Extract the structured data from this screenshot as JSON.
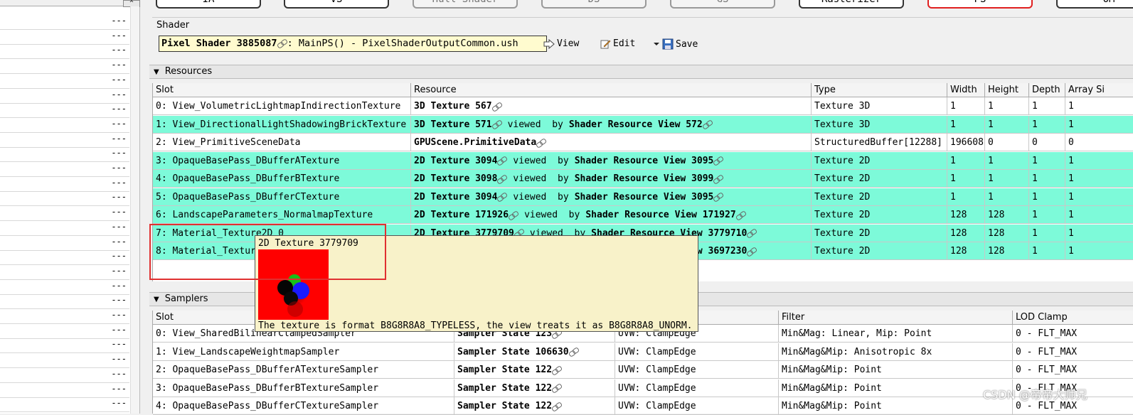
{
  "pipeline": {
    "stages": [
      {
        "label": "IA",
        "state": "normal"
      },
      {
        "label": "VS",
        "state": "normal"
      },
      {
        "label": "Hull Shader",
        "state": "disabled"
      },
      {
        "label": "DS",
        "state": "disabled"
      },
      {
        "label": "GS",
        "state": "disabled"
      },
      {
        "label": "Rasterizer",
        "state": "normal"
      },
      {
        "label": "PS",
        "state": "active"
      },
      {
        "label": "OM",
        "state": "normal"
      }
    ]
  },
  "left_panel": {
    "scroll_arrow": "^",
    "row_value": "---",
    "rows": [
      "---",
      "---",
      "---",
      "---",
      "---",
      "---",
      "---",
      "---",
      "---",
      "---",
      "---",
      "---",
      "---",
      "---",
      "---",
      "---",
      "---",
      "---",
      "---",
      "---",
      "---",
      "---",
      "---",
      "---",
      "---",
      "---",
      "---"
    ]
  },
  "shader": {
    "group_title": "Shader",
    "name_bold": "Pixel Shader 3885087",
    "name_rest": ":  MainPS()  -  PixelShaderOutputCommon.ush",
    "view_label": "View",
    "edit_label": "Edit",
    "save_label": "Save"
  },
  "resources": {
    "section_title": "Resources",
    "columns": [
      "Slot",
      "Resource",
      "Type",
      "Width",
      "Height",
      "Depth",
      "Array Si"
    ],
    "rows": [
      {
        "slot": "0: View_VolumetricLightmapIndirectionTexture",
        "resource": "3D Texture 567",
        "viewed_by": "",
        "view": "",
        "type": "Texture 3D",
        "width": "1",
        "height": "1",
        "depth": "1",
        "array": "1",
        "highlight": false
      },
      {
        "slot": "1: View_DirectionalLightShadowingBrickTexture",
        "resource": "3D Texture 571",
        "viewed_by": "viewed  by",
        "view": "Shader Resource View 572",
        "type": "Texture 3D",
        "width": "1",
        "height": "1",
        "depth": "1",
        "array": "1",
        "highlight": true
      },
      {
        "slot": "2: View_PrimitiveSceneData",
        "resource": "GPUScene.PrimitiveData",
        "viewed_by": "",
        "view": "",
        "type": "StructuredBuffer[12288]",
        "width": "196608",
        "height": "0",
        "depth": "0",
        "array": "0",
        "highlight": false
      },
      {
        "slot": "3: OpaqueBasePass_DBufferATexture",
        "resource": "2D Texture 3094",
        "viewed_by": "viewed  by",
        "view": "Shader Resource View 3095",
        "type": "Texture 2D",
        "width": "1",
        "height": "1",
        "depth": "1",
        "array": "1",
        "highlight": true
      },
      {
        "slot": "4: OpaqueBasePass_DBufferBTexture",
        "resource": "2D Texture 3098",
        "viewed_by": "viewed  by",
        "view": "Shader Resource View 3099",
        "type": "Texture 2D",
        "width": "1",
        "height": "1",
        "depth": "1",
        "array": "1",
        "highlight": true
      },
      {
        "slot": "5: OpaqueBasePass_DBufferCTexture",
        "resource": "2D Texture 3094",
        "viewed_by": "viewed  by",
        "view": "Shader Resource View 3095",
        "type": "Texture 2D",
        "width": "1",
        "height": "1",
        "depth": "1",
        "array": "1",
        "highlight": true
      },
      {
        "slot": "6: LandscapeParameters_NormalmapTexture",
        "resource": "2D Texture 171926",
        "viewed_by": "viewed  by",
        "view": "Shader Resource View 171927",
        "type": "Texture 2D",
        "width": "128",
        "height": "128",
        "depth": "1",
        "array": "1",
        "highlight": true
      },
      {
        "slot": "7: Material_Texture2D_0",
        "resource": "2D Texture 3779709",
        "viewed_by": "viewed  by",
        "view": "Shader Resource View 3779710",
        "type": "Texture 2D",
        "width": "128",
        "height": "128",
        "depth": "1",
        "array": "1",
        "highlight": true
      },
      {
        "slot": "8: Material_Texture2D_1",
        "resource": "2D Texture 3697229",
        "viewed_by": "viewed  by",
        "view": "Shader Resource View 3697230",
        "type": "Texture 2D",
        "width": "128",
        "height": "128",
        "depth": "1",
        "array": "1",
        "highlight": true
      }
    ]
  },
  "samplers": {
    "section_title": "Samplers",
    "columns": [
      "Slot",
      "",
      "",
      "Filter",
      "LOD Clamp"
    ],
    "rows": [
      {
        "slot": "0: View_SharedBilinearClampedSampler",
        "sampler": "Sampler State 123",
        "address": "UVW: ClampEdge",
        "filter": "Min&Mag: Linear, Mip: Point",
        "lod": "0 - FLT_MAX"
      },
      {
        "slot": "1: View_LandscapeWeightmapSampler",
        "sampler": "Sampler State 106630",
        "address": "UVW: ClampEdge",
        "filter": "Min&Mag&Mip: Anisotropic 8x",
        "lod": "0 - FLT_MAX"
      },
      {
        "slot": "2: OpaqueBasePass_DBufferATextureSampler",
        "sampler": "Sampler State 122",
        "address": "UVW: ClampEdge",
        "filter": "Min&Mag&Mip: Point",
        "lod": "0 - FLT_MAX"
      },
      {
        "slot": "3: OpaqueBasePass_DBufferBTextureSampler",
        "sampler": "Sampler State 122",
        "address": "UVW: ClampEdge",
        "filter": "Min&Mag&Mip: Point",
        "lod": "0 - FLT_MAX"
      },
      {
        "slot": "4: OpaqueBasePass_DBufferCTextureSampler",
        "sampler": "Sampler State 122",
        "address": "UVW: ClampEdge",
        "filter": "Min&Mag&Mip: Point",
        "lod": "0 - FLT_MAX"
      }
    ]
  },
  "tooltip": {
    "title": "2D Texture 3779709",
    "note": "The texture is format B8G8R8A8_TYPELESS, the view treats it as B8G8R8A8_UNORM."
  },
  "watermark": "CSDN @帝帝大师兄",
  "colors": {
    "highlight_row": "#7dfad9",
    "tooltip_bg": "#f8f2c9",
    "shader_name_bg": "#fffbcf",
    "active_stage_border": "#e02020",
    "annotation_rect": "#e03030"
  },
  "icons": {
    "resource_link": "link-icon",
    "view_button": "arrow-right-icon",
    "edit_button": "pencil-icon",
    "save_button": "floppy-disk-icon",
    "save_dropdown": "dropdown-triangle-icon",
    "section_toggle": "collapse-triangle-icon"
  }
}
